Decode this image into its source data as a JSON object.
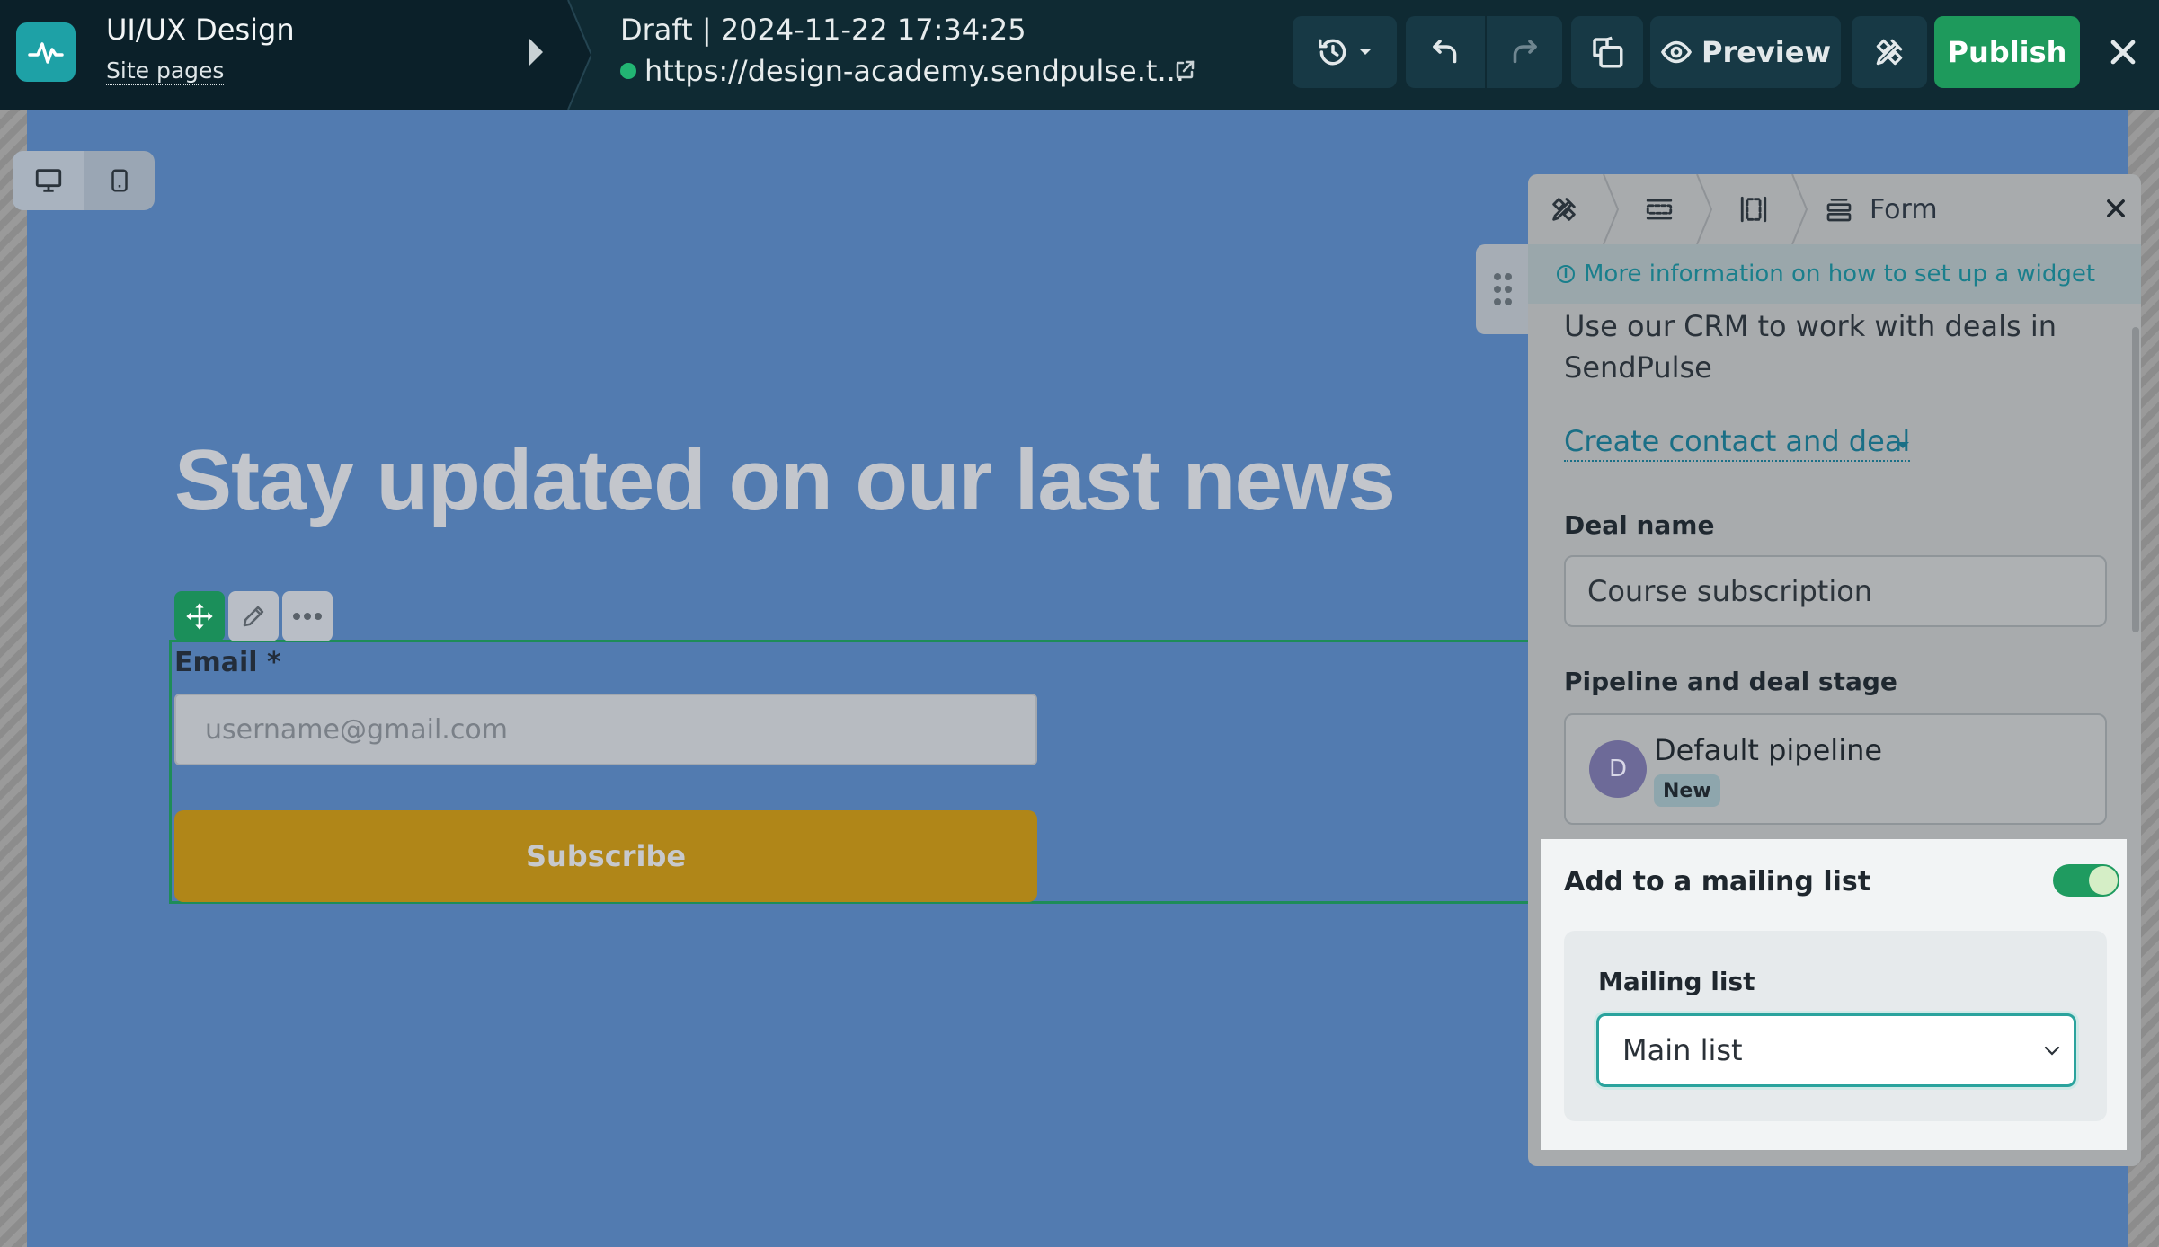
{
  "topbar": {
    "project_title": "UI/UX Design",
    "site_pages_link": "Site pages",
    "draft_status": "Draft | 2024-11-22 17:34:25",
    "site_url": "https://design-academy.sendpulse.t...",
    "preview_label": "Preview",
    "publish_label": "Publish"
  },
  "canvas": {
    "headline": "Stay updated on our last news",
    "email_label": "Email *",
    "email_placeholder": "username@gmail.com",
    "subscribe_label": "Subscribe"
  },
  "panel": {
    "tab_form_label": "Form",
    "info_link": "More information on how to set up a widget",
    "crm_text": "Use our CRM to work with deals in SendPulse",
    "crm_action": "Create contact and deal",
    "deal_name_label": "Deal name",
    "deal_name_value": "Course subscription",
    "pipeline_label": "Pipeline and deal stage",
    "pipeline_avatar_letter": "D",
    "pipeline_name": "Default pipeline",
    "pipeline_stage_badge": "New",
    "mailing_toggle_label": "Add to a mailing list",
    "mailing_toggle_on": true,
    "mailing_list_label": "Mailing list",
    "mailing_list_value": "Main list"
  },
  "colors": {
    "topbar_bg": "#0f2a33",
    "publish_green": "#1e9a5c",
    "canvas_blue": "#527bb0",
    "subscribe_gold": "#b08618",
    "accent_teal": "#1a7f8c"
  }
}
